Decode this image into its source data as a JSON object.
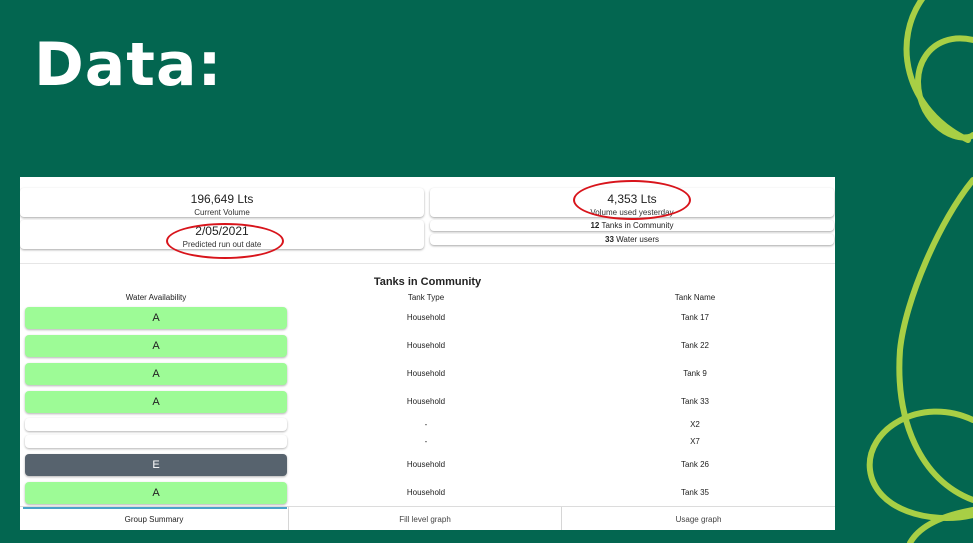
{
  "slide": {
    "title": "Data:"
  },
  "summary": {
    "current_volume": {
      "value": "196,649 Lts",
      "label": "Current Volume"
    },
    "run_out": {
      "value": "2/05/2021",
      "label": "Predicted run out date"
    },
    "volume_yesterday": {
      "value": "4,353 Lts",
      "label": "Volume used yesterday"
    },
    "tanks_count": {
      "number": "12",
      "text": "Tanks in Community"
    },
    "users_count": {
      "number": "33",
      "text": "Water users"
    }
  },
  "table": {
    "title": "Tanks in Community",
    "headers": [
      "Water Availability",
      "Tank Type",
      "Tank Name"
    ],
    "rows": [
      {
        "availability": "A",
        "type": "Household",
        "name": "Tank 17",
        "status_color": "#9dfb96"
      },
      {
        "availability": "A",
        "type": "Household",
        "name": "Tank 22",
        "status_color": "#9dfb96"
      },
      {
        "availability": "A",
        "type": "Household",
        "name": "Tank 9",
        "status_color": "#9dfb96"
      },
      {
        "availability": "A",
        "type": "Household",
        "name": "Tank 33",
        "status_color": "#9dfb96"
      },
      {
        "availability": "",
        "type": "-",
        "name": "X2",
        "status_color": "#ffffff"
      },
      {
        "availability": "",
        "type": "-",
        "name": "X7",
        "status_color": "#ffffff"
      },
      {
        "availability": "E",
        "type": "Household",
        "name": "Tank 26",
        "status_color": "#57636e"
      },
      {
        "availability": "A",
        "type": "Household",
        "name": "Tank 35",
        "status_color": "#9dfb96"
      }
    ]
  },
  "tabs": [
    "Group Summary",
    "Fill level graph",
    "Usage graph"
  ],
  "colors": {
    "background": "#036650",
    "accent_lime": "#a8cf45",
    "available": "#9dfb96",
    "empty": "#57636e",
    "annotation_red": "#d8141b"
  }
}
